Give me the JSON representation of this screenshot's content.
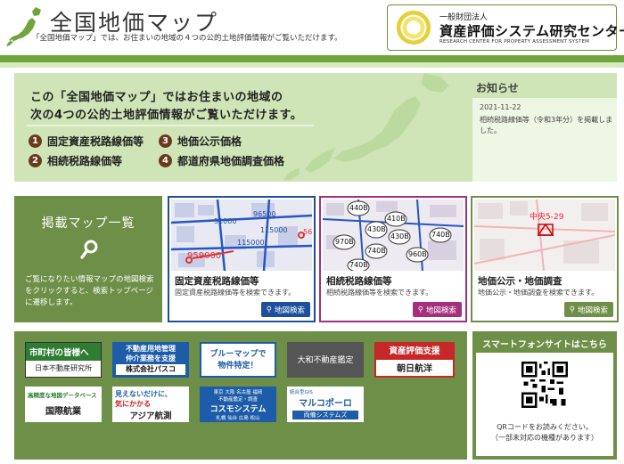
{
  "header": {
    "title": "全国地価マップ",
    "subtitle": "「全国地価マップ」では、お住まいの地域の４つの公的土地評価情報がご覧いただけます。",
    "org": {
      "small": "一般財団法人",
      "name": "資産評価システム研究センター",
      "english": "RESEARCH CENTER FOR PROPERTY ASSESSMENT SYSTEM"
    }
  },
  "hero": {
    "line1": "この「全国地価マップ」ではお住まいの地域の",
    "line2": "次の4つの公的土地評価情報がご覧いただけます。",
    "items": [
      {
        "num": "1",
        "label": "固定資産税路線価等"
      },
      {
        "num": "2",
        "label": "相続税路線価等"
      },
      {
        "num": "3",
        "label": "地価公示価格"
      },
      {
        "num": "4",
        "label": "都道府県地価調査価格"
      }
    ]
  },
  "news": {
    "title": "お知らせ",
    "date": "2021-11-22",
    "text": "相続税路線価等（令和3年分）を掲載しました。"
  },
  "map_list": {
    "title": "掲載マップ一覧",
    "desc": "ご覧になりたい情報マップの地図検索をクリックすると、検索トップページに遷移します。"
  },
  "cards": [
    {
      "title": "固定資産税路線価等",
      "desc": "固定資産税路線価等を検索できます。",
      "button": "地図検索",
      "color": "#1d4f9c",
      "map_labels": [
        "96500",
        "51000",
        "115000",
        "115000",
        "56",
        "959000"
      ]
    },
    {
      "title": "相続税路線価等",
      "desc": "相続税路線価等を検索できます。",
      "button": "地図検索",
      "color": "#a4307d",
      "map_labels": [
        "440B",
        "410B",
        "430B",
        "430B",
        "740B",
        "970B",
        "740B",
        "960B",
        "740B"
      ]
    },
    {
      "title": "地価公示・地価調査",
      "desc": "地価公示・地価調査を検索できます。",
      "button": "地図検索",
      "color": "#6e8f47",
      "map_labels": [
        "中央5-29"
      ]
    }
  ],
  "banners": [
    {
      "line1": "市町村の皆様へ",
      "line2": "日本不動産研究所"
    },
    {
      "line1": "不動産用地管理",
      "line2": "仲介業務を支援",
      "line3": "株式会社パスコ"
    },
    {
      "line1": "ブルーマップで",
      "line2": "物件特定！"
    },
    {
      "line1": "大和不動産鑑定"
    },
    {
      "line1": "資産評価支援",
      "line2": "朝日航洋"
    },
    {
      "line1": "高精度な地図データベース",
      "line2": "国際航業"
    },
    {
      "line1": "見えないだけに、",
      "line2": "気にかかる",
      "line3": "アジア航測"
    },
    {
      "line1": "東京 大阪 名古屋 福岡",
      "line2": "不動産鑑定・調査",
      "line3": "コスモシステム",
      "line4": "札幌 仙台 広島 松山"
    },
    {
      "line1": "統合型GIS",
      "line2": "マルコポーロ",
      "line3": "両備システムズ"
    }
  ],
  "smartphone": {
    "title": "スマートフォンサイトはこちら",
    "note1": "QRコードをお読みください。",
    "note2": "（一部未対応の機種があります）"
  },
  "colors": {
    "accent_green": "#6fa53a",
    "panel_green": "#6e8f47",
    "hero_bg": "#cfe5b8",
    "bullet_brown": "#6b3a1e",
    "blue": "#1d4f9c",
    "magenta": "#a4307d"
  }
}
